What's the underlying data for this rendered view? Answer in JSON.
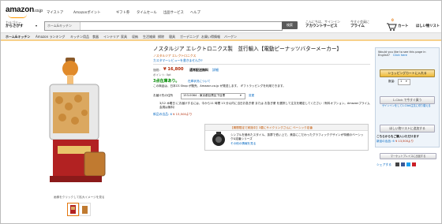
{
  "header": {
    "logo": "amazon",
    "logo_suffix": ".co.jp",
    "nav_links": [
      "マイストア",
      "Amazonポイント",
      "ギフト券",
      "タイムセール",
      "出品サービス",
      "ヘルプ"
    ],
    "category_label": "カテゴリー",
    "category_label2": "からさがす",
    "search_placeholder": "ホーム&キッチン",
    "search_button": "検索",
    "account_line1": "こんにちは、サインイン",
    "account_line2": "アカウントサービス",
    "prime_line1": "今すぐ会員に",
    "prime_line2": "プライム",
    "cart_count": "0",
    "cart_label": "カート",
    "wishlist_label": "ほしい物リスト"
  },
  "category_nav": [
    "ホーム&キッチン",
    "Amazon ランキング",
    "キッチン用品",
    "食器",
    "インテリア",
    "家具",
    "収納",
    "生活雑貨",
    "掃除",
    "寝具",
    "ガーデニング",
    "お買い得情報",
    "バーゲン"
  ],
  "product": {
    "title": "ノスタルジア エレクトロニクス製　並行輸入【電動ピーナッツバターメーカー】",
    "brand": "ノスタルジア エレクトロニクス",
    "review_link": "カスタマーレビューを書きませんか?",
    "price_label": "価格:",
    "price": "¥ 16,800",
    "shipping": "通常配送無料",
    "shipping_link": "詳細",
    "points": "ポイント: 0pt",
    "stock": "3点在庫あり。",
    "stock_note": "在庫状況について",
    "seller_info": "この商品は、日本CS Shop が販売、Amazon.co.jp が発送します。 ギフトラッピングを利用できます。",
    "delivery_label": "お届け先の住所",
    "delivery_value": "153-0064 - 東京都目黒区下目黒",
    "delivery_change": "変更",
    "delivery_note": "3/12 木曜日 にお届けするには、今から11 時間 13 分以内に当日お急ぎ便 または お急ぎ便 を選択して注文を確定してください（有料オプション。Amazonプライム会員は無料）",
    "new_offers": "新品の出品: 6",
    "new_offers_price": "¥ 13,500より",
    "thumb_caption": "画像をクリックして拡大イメージを見る"
  },
  "promo": {
    "heading": "【期間限定で実施中】3要にサイクリングさんに ベーシック定番",
    "body": "シンプルを極めたスタイル、抜群で低い上で、美容にこだわったグラフィックデザインが特徴のベーシック&定番シリーズ",
    "link": "その他の情報を見る"
  },
  "sidebar": {
    "promo_question": "Would you like to see this page in English?",
    "promo_link": "Click here",
    "cart_button": "ショッピングカートに入れる",
    "qty_label": "数量:",
    "qty_value": "1",
    "oneclick_button": "1-Click で今すぐ買う",
    "signin_link": "サインインをして1-Click注文に切り替える",
    "wishlist_button": "ほしい物リストに追加する",
    "other_sellers": "こちらからもご購入いただけます",
    "new_offers": "新品の出品: 6",
    "new_offers_price": "¥ 13,500より",
    "marketplace_button": "マーケットプレイスに出品する",
    "share_label": "シェアする"
  },
  "colors": {
    "orange": "#e47911",
    "price": "#b12704",
    "link": "#0066c0",
    "green": "#008a00"
  }
}
